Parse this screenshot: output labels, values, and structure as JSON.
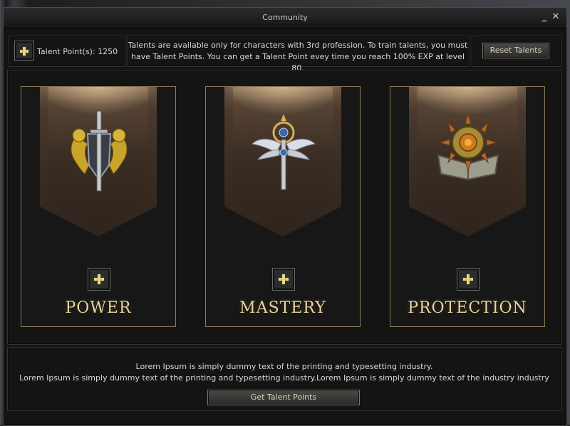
{
  "window": {
    "title": "Community",
    "minimize_glyph": "_",
    "close_glyph": "✕"
  },
  "header": {
    "talent_points_label": "Talent Point(s): 1250",
    "info_line1": "Talents are available only for characters with 3rd profession. To train talents, you must",
    "info_line2": "have Talent Points. You can get a Talent Point evey time you reach 100% EXP at level 80.",
    "reset_label": "Reset Talents"
  },
  "talents": [
    {
      "name": "POWER",
      "icon": "lion-shield-sword-icon"
    },
    {
      "name": "MASTERY",
      "icon": "winged-staff-icon"
    },
    {
      "name": "PROTECTION",
      "icon": "sun-book-icon"
    }
  ],
  "footer": {
    "line1": "Lorem Ipsum is simply dummy text of the printing and typesetting industry.",
    "line2": "Lorem Ipsum is simply dummy text of the printing and typesetting industry.Lorem Ipsum is simply dummy text of the industry industry",
    "get_points_label": "Get Talent Points"
  },
  "colors": {
    "title_gold": "#e8d6a6",
    "plus_gold": "#e7d98a",
    "card_border": "#8a7a55"
  }
}
